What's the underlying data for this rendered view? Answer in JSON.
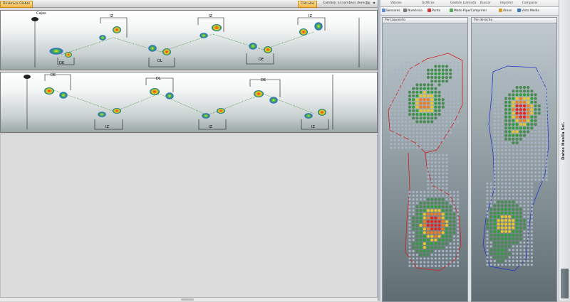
{
  "tabs": {
    "active": "Dinámica Global",
    "pin_icon": "pin-icon",
    "close_icon": "close-icon"
  },
  "toolbar": {
    "calc_label": "Cálculos",
    "swap_label": "Cambiar al nombres derecho"
  },
  "status": {
    "check_icon": "checkmark-icon"
  },
  "gait_top": {
    "start_label": "Cajas",
    "labels": [
      "DE",
      "DL",
      "DE",
      "IZ",
      "IZ",
      "IZ"
    ]
  },
  "gait_bottom": {
    "labels": [
      "DE",
      "DL",
      "DE",
      "IZ",
      "IZ",
      "IZ"
    ]
  },
  "right_ribbon": {
    "tabs": [
      "Valores",
      "Gráficos",
      "Gestión Llamada",
      "Buscar",
      "Imprimir",
      "Comparar"
    ],
    "tools": [
      "Sensores",
      "Numérico",
      "Punto",
      "Modo Pipe/Comprimir",
      "Áreas",
      "Vista Media"
    ]
  },
  "footprints": {
    "left_title": "Pie Izquierdo",
    "right_title": "Pie derecho"
  },
  "side_panel": {
    "label": "Datos Huella Sel."
  },
  "colors": {
    "accent": "#f5b544",
    "left_outline": "#d32020",
    "right_outline": "#2233cc"
  }
}
